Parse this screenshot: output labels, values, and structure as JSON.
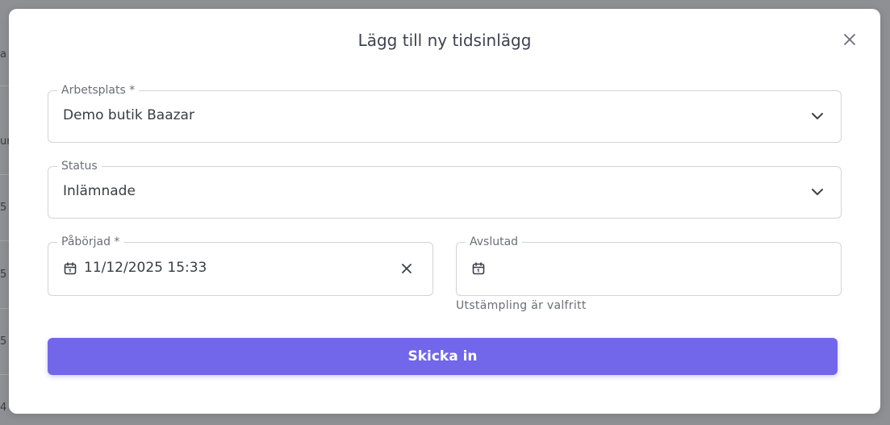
{
  "background": {
    "row_chars": [
      "a",
      "ur",
      "5",
      "5",
      "5",
      "4"
    ]
  },
  "dialog": {
    "title": "Lägg till ny tidsinlägg",
    "close_icon": "close-icon"
  },
  "fields": {
    "workplace": {
      "label": "Arbetsplats *",
      "value": "Demo butik Baazar"
    },
    "status": {
      "label": "Status",
      "value": "Inlämnade"
    },
    "started": {
      "label": "Påbörjad *",
      "value": "11/12/2025 15:33"
    },
    "ended": {
      "label": "Avslutad",
      "value": "",
      "helper": "Utstämpling är valfritt"
    }
  },
  "actions": {
    "submit_label": "Skicka in"
  },
  "colors": {
    "accent": "#7266ea",
    "backdrop": "#8e9094",
    "border": "#d3d4d8"
  }
}
